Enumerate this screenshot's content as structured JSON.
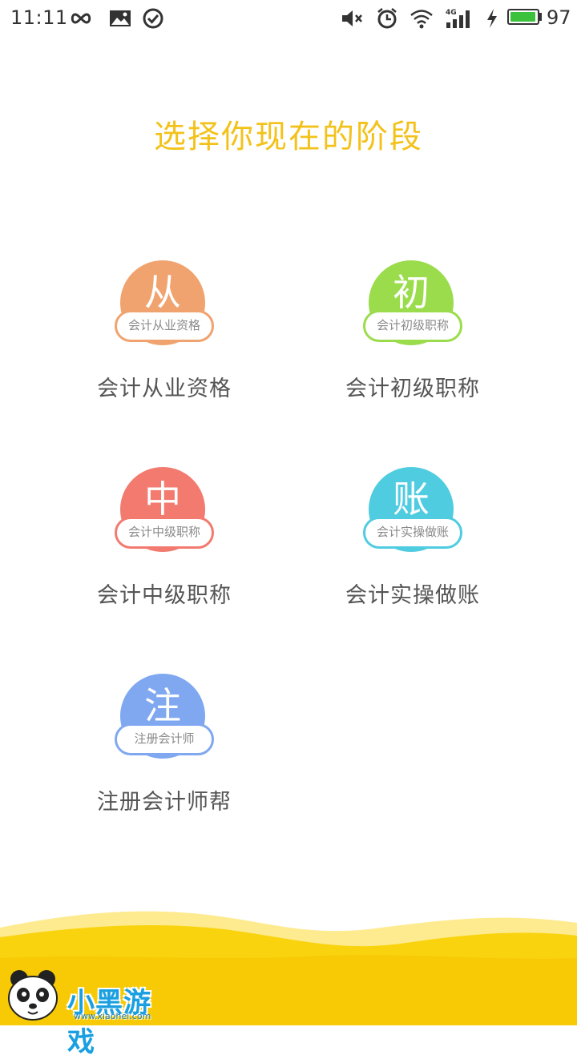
{
  "status_bar": {
    "time": "11:11",
    "battery_level": "97",
    "battery_fraction": 0.97,
    "icons": [
      "infinity-icon",
      "image-icon",
      "check-circle-icon",
      "mute-icon",
      "alarm-icon",
      "wifi-icon",
      "signal-4g-icon",
      "charging-icon",
      "battery-icon"
    ]
  },
  "page_title": "选择你现在的阶段",
  "stages": [
    {
      "badge_char": "从",
      "badge_text": "会计从业资格",
      "label": "会计从业资格",
      "color": "#f0a36e"
    },
    {
      "badge_char": "初",
      "badge_text": "会计初级职称",
      "label": "会计初级职称",
      "color": "#9bdc4c"
    },
    {
      "badge_char": "中",
      "badge_text": "会计中级职称",
      "label": "会计中级职称",
      "color": "#f27a6e"
    },
    {
      "badge_char": "账",
      "badge_text": "会计实操做账",
      "label": "会计实操做账",
      "color": "#4fcce0"
    },
    {
      "badge_char": "注",
      "badge_text": "注册会计师",
      "label": "注册会计师帮",
      "color": "#7fa8f0"
    }
  ],
  "watermark": {
    "brand": "小黑游戏",
    "url": "www.xiaohei.com"
  },
  "colors": {
    "accent_yellow": "#f3c21a",
    "wave_yellow": "#fad30f"
  }
}
